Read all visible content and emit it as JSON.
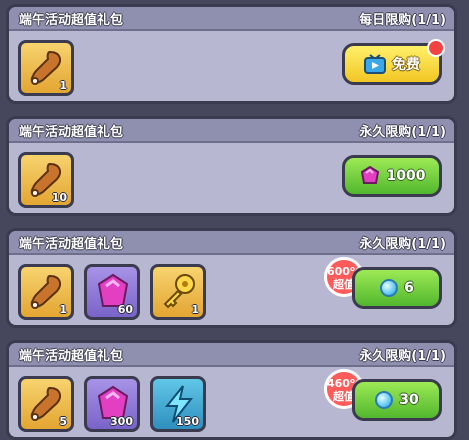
{
  "packs": [
    {
      "title": "端午活动超值礼包",
      "limit": "每日限购(1/1)",
      "items": [
        {
          "icon": "drumstick-icon",
          "qty": "1"
        }
      ],
      "button": {
        "type": "free",
        "label": "免费",
        "icon": "tv-icon",
        "notify": true
      }
    },
    {
      "title": "端午活动超值礼包",
      "limit": "永久限购(1/1)",
      "items": [
        {
          "icon": "drumstick-icon",
          "qty": "10"
        }
      ],
      "button": {
        "type": "gem-price",
        "label": "1000",
        "icon": "pink-gem-icon"
      }
    },
    {
      "title": "端午活动超值礼包",
      "limit": "永久限购(1/1)",
      "badge": {
        "pct": "600%",
        "label": "超值"
      },
      "items": [
        {
          "icon": "drumstick-icon",
          "qty": "1"
        },
        {
          "icon": "pink-gem-icon",
          "qty": "60"
        },
        {
          "icon": "golden-key-icon",
          "qty": "1"
        }
      ],
      "button": {
        "type": "coin-price",
        "label": "6",
        "icon": "coin-icon"
      }
    },
    {
      "title": "端午活动超值礼包",
      "limit": "永久限购(1/1)",
      "badge": {
        "pct": "460%",
        "label": "超值"
      },
      "items": [
        {
          "icon": "drumstick-icon",
          "qty": "5"
        },
        {
          "icon": "pink-gem-icon",
          "qty": "300"
        },
        {
          "icon": "lightning-icon",
          "qty": "150"
        }
      ],
      "button": {
        "type": "coin-price",
        "label": "30",
        "icon": "coin-icon"
      }
    }
  ],
  "colors": {
    "background": "#46465c",
    "panel": "#b7b7d2",
    "green_button": "#6fd236",
    "yellow_button": "#f8de3e",
    "badge_red": "#ff5b5b"
  }
}
